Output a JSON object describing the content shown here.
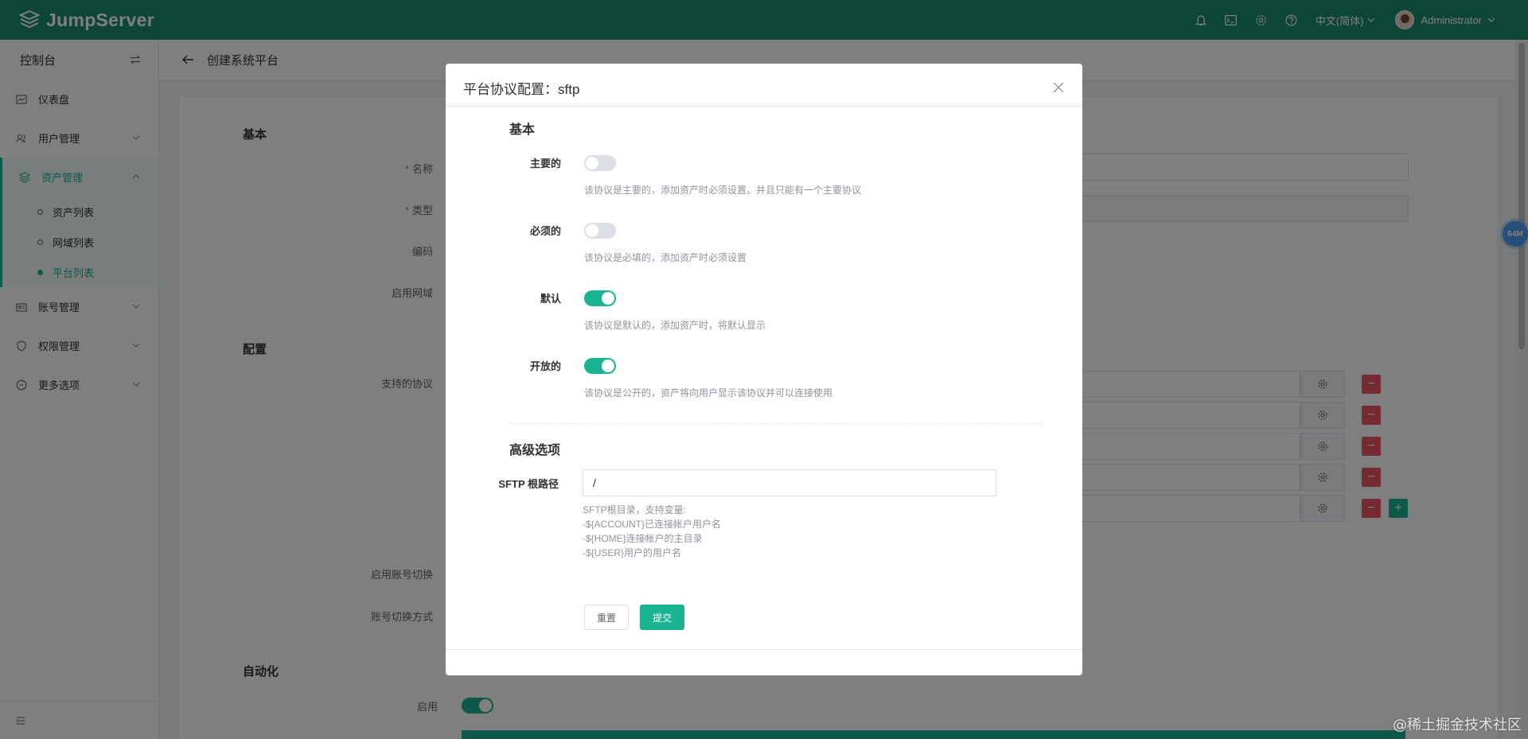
{
  "app": {
    "logo_text": "JumpServer"
  },
  "topbar": {
    "language": "中文(简体)",
    "username": "Administrator",
    "icons": [
      "bell-icon",
      "terminal-icon",
      "gear-icon",
      "help-icon"
    ]
  },
  "sidebar": {
    "header": "控制台",
    "items": [
      {
        "label": "仪表盘",
        "icon": "dashboard-icon"
      },
      {
        "label": "用户管理",
        "icon": "users-icon"
      },
      {
        "label": "资产管理",
        "icon": "assets-icon"
      },
      {
        "label": "账号管理",
        "icon": "accounts-icon"
      },
      {
        "label": "权限管理",
        "icon": "shield-icon"
      },
      {
        "label": "更多选项",
        "icon": "more-icon"
      }
    ],
    "sub_items": [
      "资产列表",
      "网域列表",
      "平台列表"
    ]
  },
  "page": {
    "title": "创建系统平台",
    "sections": {
      "basic": "基本",
      "config": "配置",
      "automation": "自动化"
    },
    "labels": {
      "name": "名称",
      "type": "类型",
      "code": "编码",
      "enable_domain": "启用网域",
      "protocols": "支持的协议",
      "enable_su": "启用账号切换",
      "su_method": "账号切换方式",
      "enable": "启用"
    },
    "required_mark": "*",
    "minus": "−",
    "plus": "+"
  },
  "badge": {
    "memory": "64M"
  },
  "dialog": {
    "title": "平台协议配置：sftp",
    "section_basic": "基本",
    "fields": [
      {
        "label": "主要的",
        "on": false,
        "help": "该协议是主要的，添加资产时必须设置。并且只能有一个主要协议"
      },
      {
        "label": "必须的",
        "on": false,
        "help": "该协议是必填的，添加资产时必须设置"
      },
      {
        "label": "默认",
        "on": true,
        "help": "该协议是默认的，添加资产时，将默认显示"
      },
      {
        "label": "开放的",
        "on": true,
        "help": "该协议是公开的，资产将向用户显示该协议并可以连接使用"
      }
    ],
    "section_advanced": "高级选项",
    "sftp_label": "SFTP 根路径",
    "sftp_value": "/",
    "sftp_help": [
      "SFTP根目录，支持变量:",
      "-${ACCOUNT}已连接帐户用户名",
      "-${HOME}连接帐户的主目录",
      "-${USER}用户的用户名"
    ],
    "reset_label": "重置",
    "submit_label": "提交"
  },
  "watermark": "@稀土掘金技术社区",
  "colors": {
    "header": "#1a8a70",
    "accent": "#1ab394",
    "danger": "#ed5565"
  }
}
